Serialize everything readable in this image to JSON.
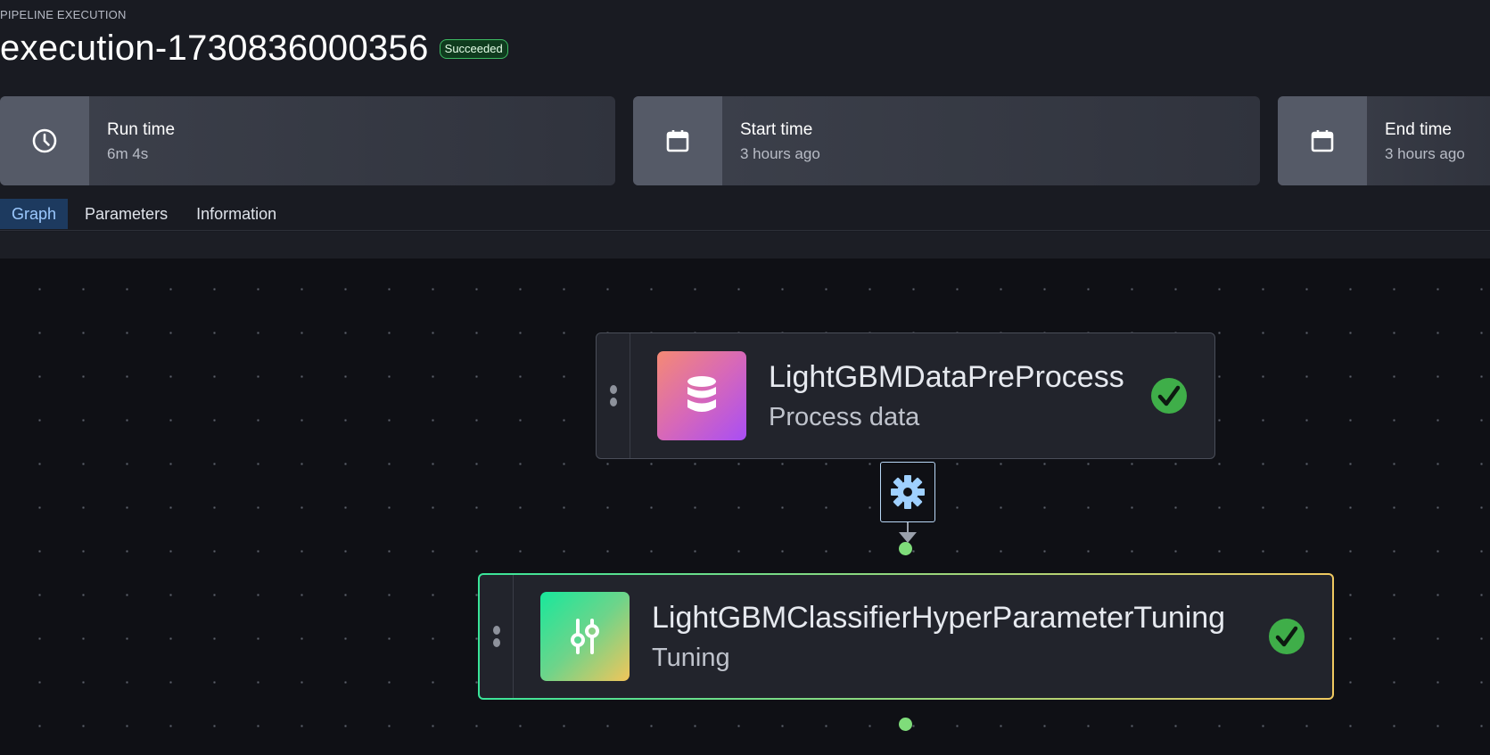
{
  "header": {
    "eyebrow": "PIPELINE EXECUTION",
    "title": "execution-1730836000356",
    "status": "Succeeded",
    "status_color": "#3dbb62"
  },
  "cards": [
    {
      "label": "Run time",
      "value": "6m 4s",
      "icon": "clock-icon"
    },
    {
      "label": "Start time",
      "value": "3 hours ago",
      "icon": "calendar-icon"
    },
    {
      "label": "End time",
      "value": "3 hours ago",
      "icon": "calendar-icon"
    }
  ],
  "tabs": [
    {
      "label": "Graph",
      "active": true
    },
    {
      "label": "Parameters",
      "active": false
    },
    {
      "label": "Information",
      "active": false
    }
  ],
  "graph": {
    "nodes": [
      {
        "name": "LightGBMDataPreProcess",
        "subtitle": "Process data",
        "icon": "database-icon",
        "status": "succeeded"
      },
      {
        "name": "LightGBMClassifierHyperParameterTuning",
        "subtitle": "Tuning",
        "icon": "sliders-icon",
        "status": "succeeded",
        "selected": true
      }
    ],
    "edge_icon": "gear-icon",
    "accent_colors": {
      "success": "#3fae49",
      "edge": "#b9d8f7"
    }
  }
}
